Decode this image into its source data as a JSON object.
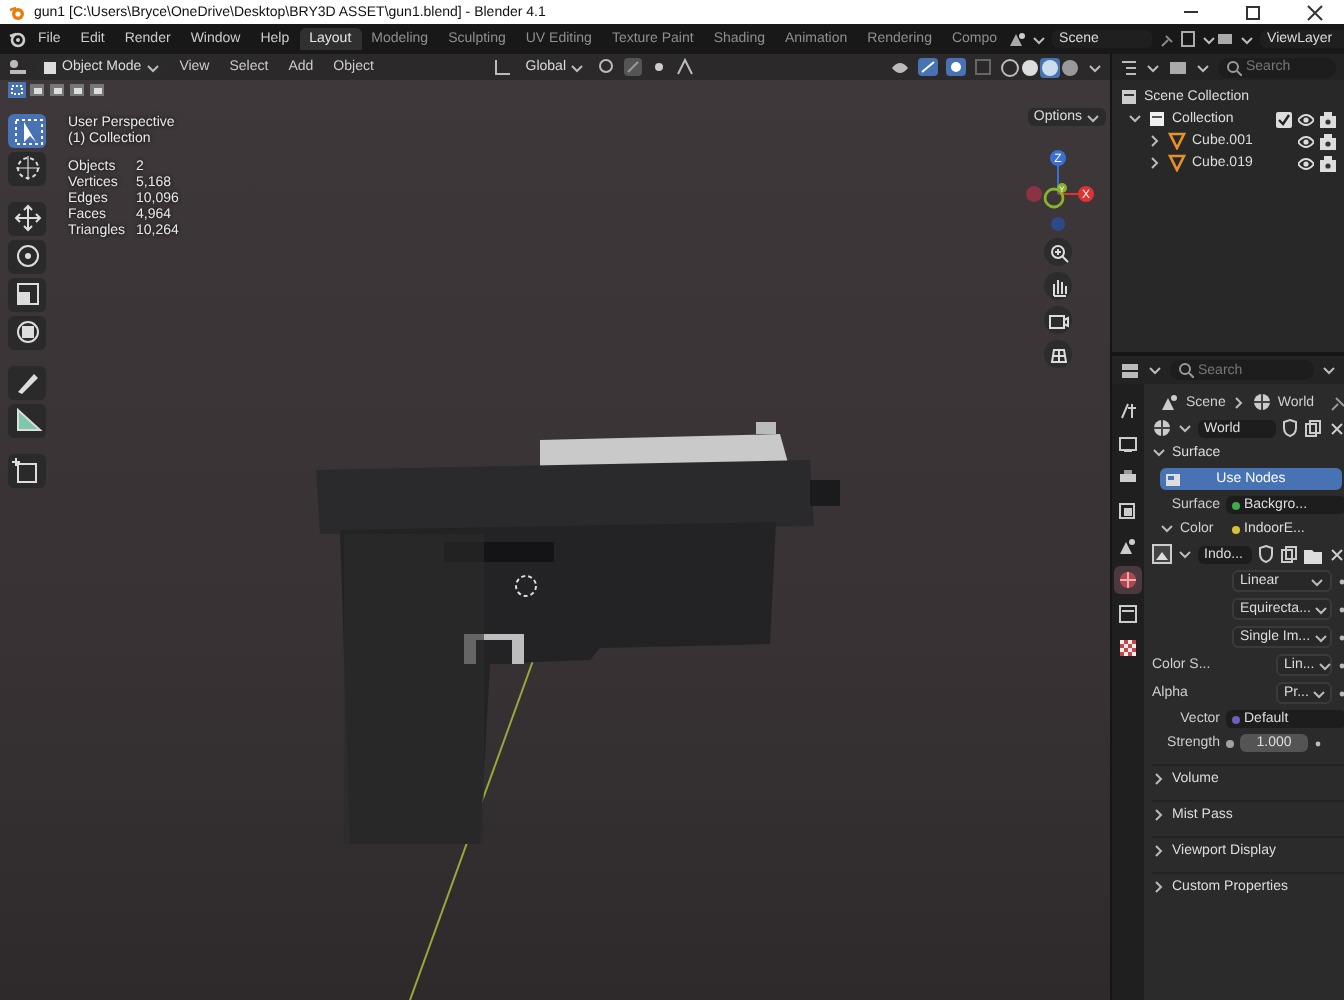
{
  "window": {
    "title": "gun1 [C:\\Users\\Bryce\\OneDrive\\Desktop\\BRY3D ASSET\\gun1.blend] - Blender 4.1"
  },
  "menu": [
    "File",
    "Edit",
    "Render",
    "Window",
    "Help"
  ],
  "workspaces": [
    {
      "label": "Layout",
      "selected": true
    },
    {
      "label": "Modeling",
      "selected": false
    },
    {
      "label": "Sculpting",
      "selected": false
    },
    {
      "label": "UV Editing",
      "selected": false
    },
    {
      "label": "Texture Paint",
      "selected": false
    },
    {
      "label": "Shading",
      "selected": false
    },
    {
      "label": "Animation",
      "selected": false
    },
    {
      "label": "Rendering",
      "selected": false
    },
    {
      "label": "Compo",
      "selected": false
    }
  ],
  "scene": "Scene",
  "view_layer": "ViewLayer",
  "viewport": {
    "mode": "Object Mode",
    "menus": [
      "View",
      "Select",
      "Add",
      "Object"
    ],
    "orientation": "Global",
    "options": "Options",
    "tools": [
      {
        "kind": "select",
        "selected": true
      },
      {
        "kind": "cursor",
        "selected": false
      },
      {
        "kind": "move",
        "selected": false
      },
      {
        "kind": "rotate",
        "selected": false
      },
      {
        "kind": "scale",
        "selected": false
      },
      {
        "kind": "transform",
        "selected": false
      },
      {
        "kind": "annotate",
        "selected": false
      },
      {
        "kind": "measure",
        "selected": false
      },
      {
        "kind": "add",
        "selected": false
      }
    ],
    "gizmo_axes": [
      "Z",
      "X",
      "Y"
    ]
  },
  "overlay": {
    "view": "User Perspective",
    "collection": "(1) Collection",
    "stats": [
      {
        "label": "Objects",
        "value": "2"
      },
      {
        "label": "Vertices",
        "value": "5,168"
      },
      {
        "label": "Edges",
        "value": "10,096"
      },
      {
        "label": "Faces",
        "value": "4,964"
      },
      {
        "label": "Triangles",
        "value": "10,264"
      }
    ]
  },
  "outliner": {
    "search_placeholder": "Search",
    "root": "Scene Collection",
    "collections": [
      {
        "label": "Collection",
        "expanded": true,
        "checked": true,
        "children": [
          {
            "label": "Cube.001",
            "expanded": false
          },
          {
            "label": "Cube.019",
            "expanded": false
          }
        ]
      }
    ]
  },
  "properties": {
    "search_placeholder": "Search",
    "tabs": [
      {
        "kind": "tool",
        "selected": false
      },
      {
        "kind": "render",
        "selected": false
      },
      {
        "kind": "output",
        "selected": false
      },
      {
        "kind": "view_layer",
        "selected": false
      },
      {
        "kind": "scene",
        "selected": false
      },
      {
        "kind": "world",
        "selected": true
      },
      {
        "kind": "collection",
        "selected": false
      },
      {
        "kind": "texture",
        "selected": false
      }
    ],
    "breadcrumb": [
      "Scene",
      "World"
    ],
    "datablock": "World",
    "surface": {
      "title": "Surface",
      "expanded": true,
      "use_nodes": {
        "label": "Use Nodes",
        "on": true
      },
      "rows": [
        {
          "kind": "socket",
          "label": "Surface",
          "value": "Backgro...",
          "color": "#3fae4a"
        },
        {
          "kind": "group",
          "label": "Color",
          "value": "IndoorE...",
          "color": "#d8c23a",
          "expanded": true
        },
        {
          "kind": "image",
          "value": "Indo..."
        },
        {
          "kind": "dropdown",
          "value": "Linear"
        },
        {
          "kind": "dropdown",
          "value": "Equirecta..."
        },
        {
          "kind": "dropdown",
          "value": "Single Im..."
        },
        {
          "kind": "dropdown",
          "label": "Color S...",
          "value": "Lin..."
        },
        {
          "kind": "dropdown",
          "label": "Alpha",
          "value": "Pr..."
        },
        {
          "kind": "socket",
          "label": "Vector",
          "value": "Default",
          "color": "#6c5fb8"
        },
        {
          "kind": "number",
          "label": "Strength",
          "value": "1.000",
          "color": "#a1a1a1"
        }
      ]
    },
    "panels": [
      {
        "title": "Volume",
        "expanded": false
      },
      {
        "title": "Mist Pass",
        "expanded": false
      },
      {
        "title": "Viewport Display",
        "expanded": false
      },
      {
        "title": "Custom Properties",
        "expanded": false
      }
    ]
  }
}
